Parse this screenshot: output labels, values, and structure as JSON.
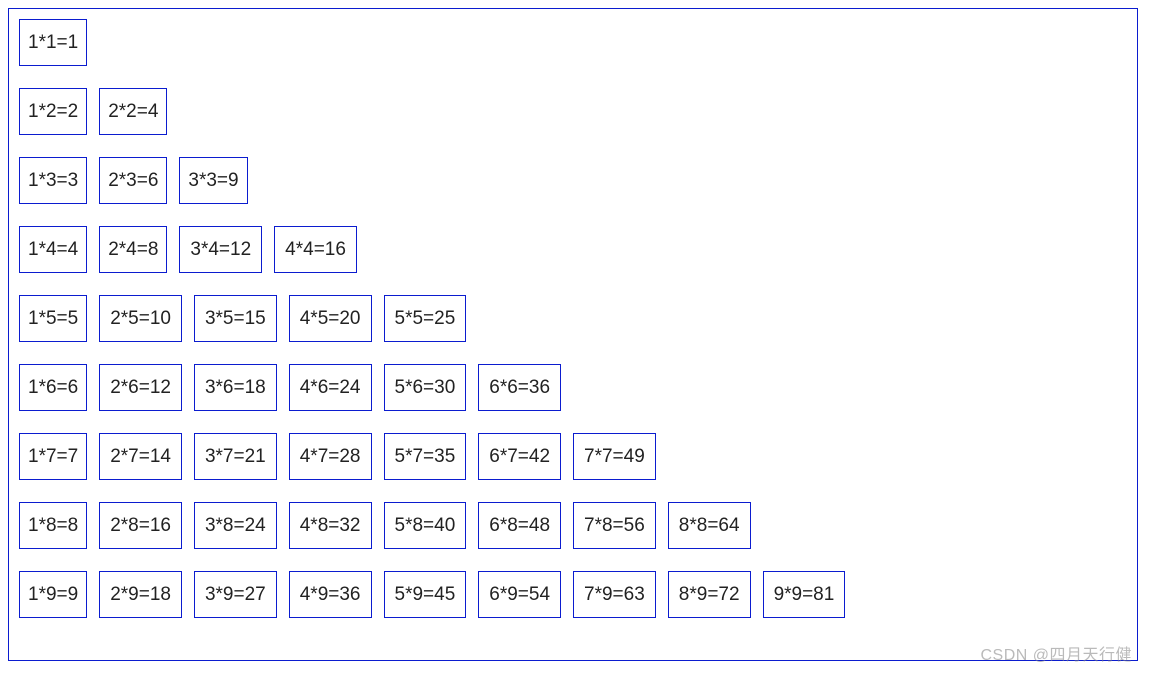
{
  "chart_data": {
    "type": "table",
    "title": "9×9 multiplication table (triangular)",
    "rows": [
      [
        {
          "i": 1,
          "j": 1,
          "v": 1
        }
      ],
      [
        {
          "i": 1,
          "j": 2,
          "v": 2
        },
        {
          "i": 2,
          "j": 2,
          "v": 4
        }
      ],
      [
        {
          "i": 1,
          "j": 3,
          "v": 3
        },
        {
          "i": 2,
          "j": 3,
          "v": 6
        },
        {
          "i": 3,
          "j": 3,
          "v": 9
        }
      ],
      [
        {
          "i": 1,
          "j": 4,
          "v": 4
        },
        {
          "i": 2,
          "j": 4,
          "v": 8
        },
        {
          "i": 3,
          "j": 4,
          "v": 12
        },
        {
          "i": 4,
          "j": 4,
          "v": 16
        }
      ],
      [
        {
          "i": 1,
          "j": 5,
          "v": 5
        },
        {
          "i": 2,
          "j": 5,
          "v": 10
        },
        {
          "i": 3,
          "j": 5,
          "v": 15
        },
        {
          "i": 4,
          "j": 5,
          "v": 20
        },
        {
          "i": 5,
          "j": 5,
          "v": 25
        }
      ],
      [
        {
          "i": 1,
          "j": 6,
          "v": 6
        },
        {
          "i": 2,
          "j": 6,
          "v": 12
        },
        {
          "i": 3,
          "j": 6,
          "v": 18
        },
        {
          "i": 4,
          "j": 6,
          "v": 24
        },
        {
          "i": 5,
          "j": 6,
          "v": 30
        },
        {
          "i": 6,
          "j": 6,
          "v": 36
        }
      ],
      [
        {
          "i": 1,
          "j": 7,
          "v": 7
        },
        {
          "i": 2,
          "j": 7,
          "v": 14
        },
        {
          "i": 3,
          "j": 7,
          "v": 21
        },
        {
          "i": 4,
          "j": 7,
          "v": 28
        },
        {
          "i": 5,
          "j": 7,
          "v": 35
        },
        {
          "i": 6,
          "j": 7,
          "v": 42
        },
        {
          "i": 7,
          "j": 7,
          "v": 49
        }
      ],
      [
        {
          "i": 1,
          "j": 8,
          "v": 8
        },
        {
          "i": 2,
          "j": 8,
          "v": 16
        },
        {
          "i": 3,
          "j": 8,
          "v": 24
        },
        {
          "i": 4,
          "j": 8,
          "v": 32
        },
        {
          "i": 5,
          "j": 8,
          "v": 40
        },
        {
          "i": 6,
          "j": 8,
          "v": 48
        },
        {
          "i": 7,
          "j": 8,
          "v": 56
        },
        {
          "i": 8,
          "j": 8,
          "v": 64
        }
      ],
      [
        {
          "i": 1,
          "j": 9,
          "v": 9
        },
        {
          "i": 2,
          "j": 9,
          "v": 18
        },
        {
          "i": 3,
          "j": 9,
          "v": 27
        },
        {
          "i": 4,
          "j": 9,
          "v": 36
        },
        {
          "i": 5,
          "j": 9,
          "v": 45
        },
        {
          "i": 6,
          "j": 9,
          "v": 54
        },
        {
          "i": 7,
          "j": 9,
          "v": 63
        },
        {
          "i": 8,
          "j": 9,
          "v": 72
        },
        {
          "i": 9,
          "j": 9,
          "v": 81
        }
      ]
    ]
  },
  "table": {
    "rows": [
      {
        "cells": [
          {
            "t": "1*1=1"
          }
        ]
      },
      {
        "cells": [
          {
            "t": "1*2=2"
          },
          {
            "t": "2*2=4"
          }
        ]
      },
      {
        "cells": [
          {
            "t": "1*3=3"
          },
          {
            "t": "2*3=6"
          },
          {
            "t": "3*3=9"
          }
        ]
      },
      {
        "cells": [
          {
            "t": "1*4=4"
          },
          {
            "t": "2*4=8"
          },
          {
            "t": "3*4=12"
          },
          {
            "t": "4*4=16"
          }
        ]
      },
      {
        "cells": [
          {
            "t": "1*5=5"
          },
          {
            "t": "2*5=10"
          },
          {
            "t": "3*5=15"
          },
          {
            "t": "4*5=20"
          },
          {
            "t": "5*5=25"
          }
        ]
      },
      {
        "cells": [
          {
            "t": "1*6=6"
          },
          {
            "t": "2*6=12"
          },
          {
            "t": "3*6=18"
          },
          {
            "t": "4*6=24"
          },
          {
            "t": "5*6=30"
          },
          {
            "t": "6*6=36"
          }
        ]
      },
      {
        "cells": [
          {
            "t": "1*7=7"
          },
          {
            "t": "2*7=14"
          },
          {
            "t": "3*7=21"
          },
          {
            "t": "4*7=28"
          },
          {
            "t": "5*7=35"
          },
          {
            "t": "6*7=42"
          },
          {
            "t": "7*7=49"
          }
        ]
      },
      {
        "cells": [
          {
            "t": "1*8=8"
          },
          {
            "t": "2*8=16"
          },
          {
            "t": "3*8=24"
          },
          {
            "t": "4*8=32"
          },
          {
            "t": "5*8=40"
          },
          {
            "t": "6*8=48"
          },
          {
            "t": "7*8=56"
          },
          {
            "t": "8*8=64"
          }
        ]
      },
      {
        "cells": [
          {
            "t": "1*9=9"
          },
          {
            "t": "2*9=18"
          },
          {
            "t": "3*9=27"
          },
          {
            "t": "4*9=36"
          },
          {
            "t": "5*9=45"
          },
          {
            "t": "6*9=54"
          },
          {
            "t": "7*9=63"
          },
          {
            "t": "8*9=72"
          },
          {
            "t": "9*9=81"
          }
        ]
      }
    ]
  },
  "watermark": "CSDN @四月天行健"
}
